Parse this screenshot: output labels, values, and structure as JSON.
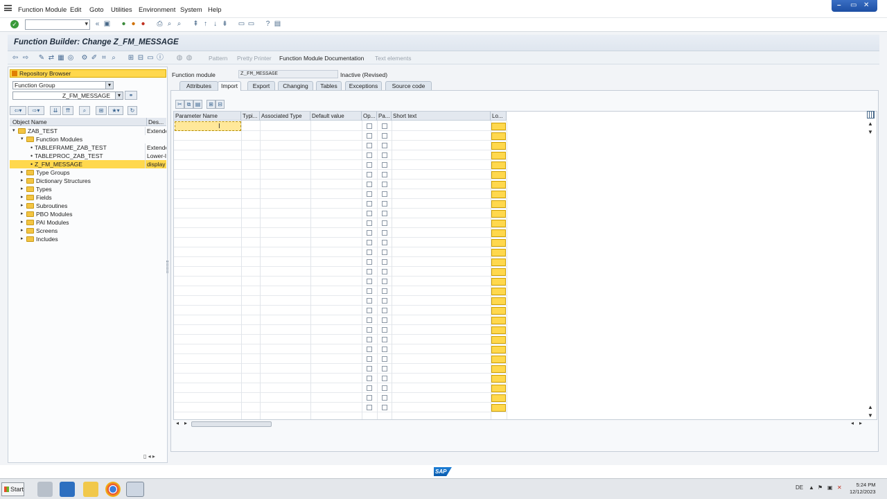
{
  "menu": [
    "Function Module",
    "Edit",
    "Goto",
    "Utilities",
    "Environment",
    "System",
    "Help"
  ],
  "window_controls": {
    "minimize": "–",
    "restore": "▭",
    "close": "✕"
  },
  "title": "Function Builder: Change Z_FM_MESSAGE",
  "app_toolbar": {
    "pattern": "Pattern",
    "pretty_printer": "Pretty Printer",
    "fm_doc": "Function Module Documentation",
    "text_elements": "Text elements"
  },
  "left": {
    "repo_button": "Repository Browser",
    "object_type": "Function Group",
    "object_name": "Z_FM_MESSAGE",
    "col_object": "Object Name",
    "col_desc": "Des...",
    "tree": [
      {
        "label": "ZAB_TEST",
        "desc": "Extende",
        "kind": "folder-open",
        "indent": 0
      },
      {
        "label": "Function Modules",
        "desc": "",
        "kind": "folder-open",
        "indent": 1
      },
      {
        "label": "TABLEFRAME_ZAB_TEST",
        "desc": "Extende",
        "kind": "leaf",
        "indent": 2
      },
      {
        "label": "TABLEPROC_ZAB_TEST",
        "desc": "Lower-le",
        "kind": "leaf",
        "indent": 2
      },
      {
        "label": "Z_FM_MESSAGE",
        "desc": "display m",
        "kind": "leaf",
        "indent": 2,
        "selected": true
      },
      {
        "label": "Type Groups",
        "desc": "",
        "kind": "folder",
        "indent": 1
      },
      {
        "label": "Dictionary Structures",
        "desc": "",
        "kind": "folder",
        "indent": 1
      },
      {
        "label": "Types",
        "desc": "",
        "kind": "folder",
        "indent": 1
      },
      {
        "label": "Fields",
        "desc": "",
        "kind": "folder",
        "indent": 1
      },
      {
        "label": "Subroutines",
        "desc": "",
        "kind": "folder",
        "indent": 1
      },
      {
        "label": "PBO Modules",
        "desc": "",
        "kind": "folder",
        "indent": 1
      },
      {
        "label": "PAI Modules",
        "desc": "",
        "kind": "folder",
        "indent": 1
      },
      {
        "label": "Screens",
        "desc": "",
        "kind": "folder",
        "indent": 1
      },
      {
        "label": "Includes",
        "desc": "",
        "kind": "folder",
        "indent": 1
      }
    ]
  },
  "fm": {
    "label": "Function module",
    "value": "Z_FM_MESSAGE",
    "status": "Inactive (Revised)"
  },
  "tabs": [
    "Attributes",
    "Import",
    "Export",
    "Changing",
    "Tables",
    "Exceptions",
    "Source code"
  ],
  "active_tab": "Import",
  "grid": {
    "columns": [
      "Parameter Name",
      "Typi...",
      "Associated Type",
      "Default value",
      "Op...",
      "Pa...",
      "Short text",
      "Lo..."
    ],
    "row_count": 30
  },
  "status": {
    "sap": "SAP"
  },
  "taskbar": {
    "start": "Start",
    "lang": "DE",
    "time": "5:24 PM",
    "date": "12/12/2023"
  }
}
